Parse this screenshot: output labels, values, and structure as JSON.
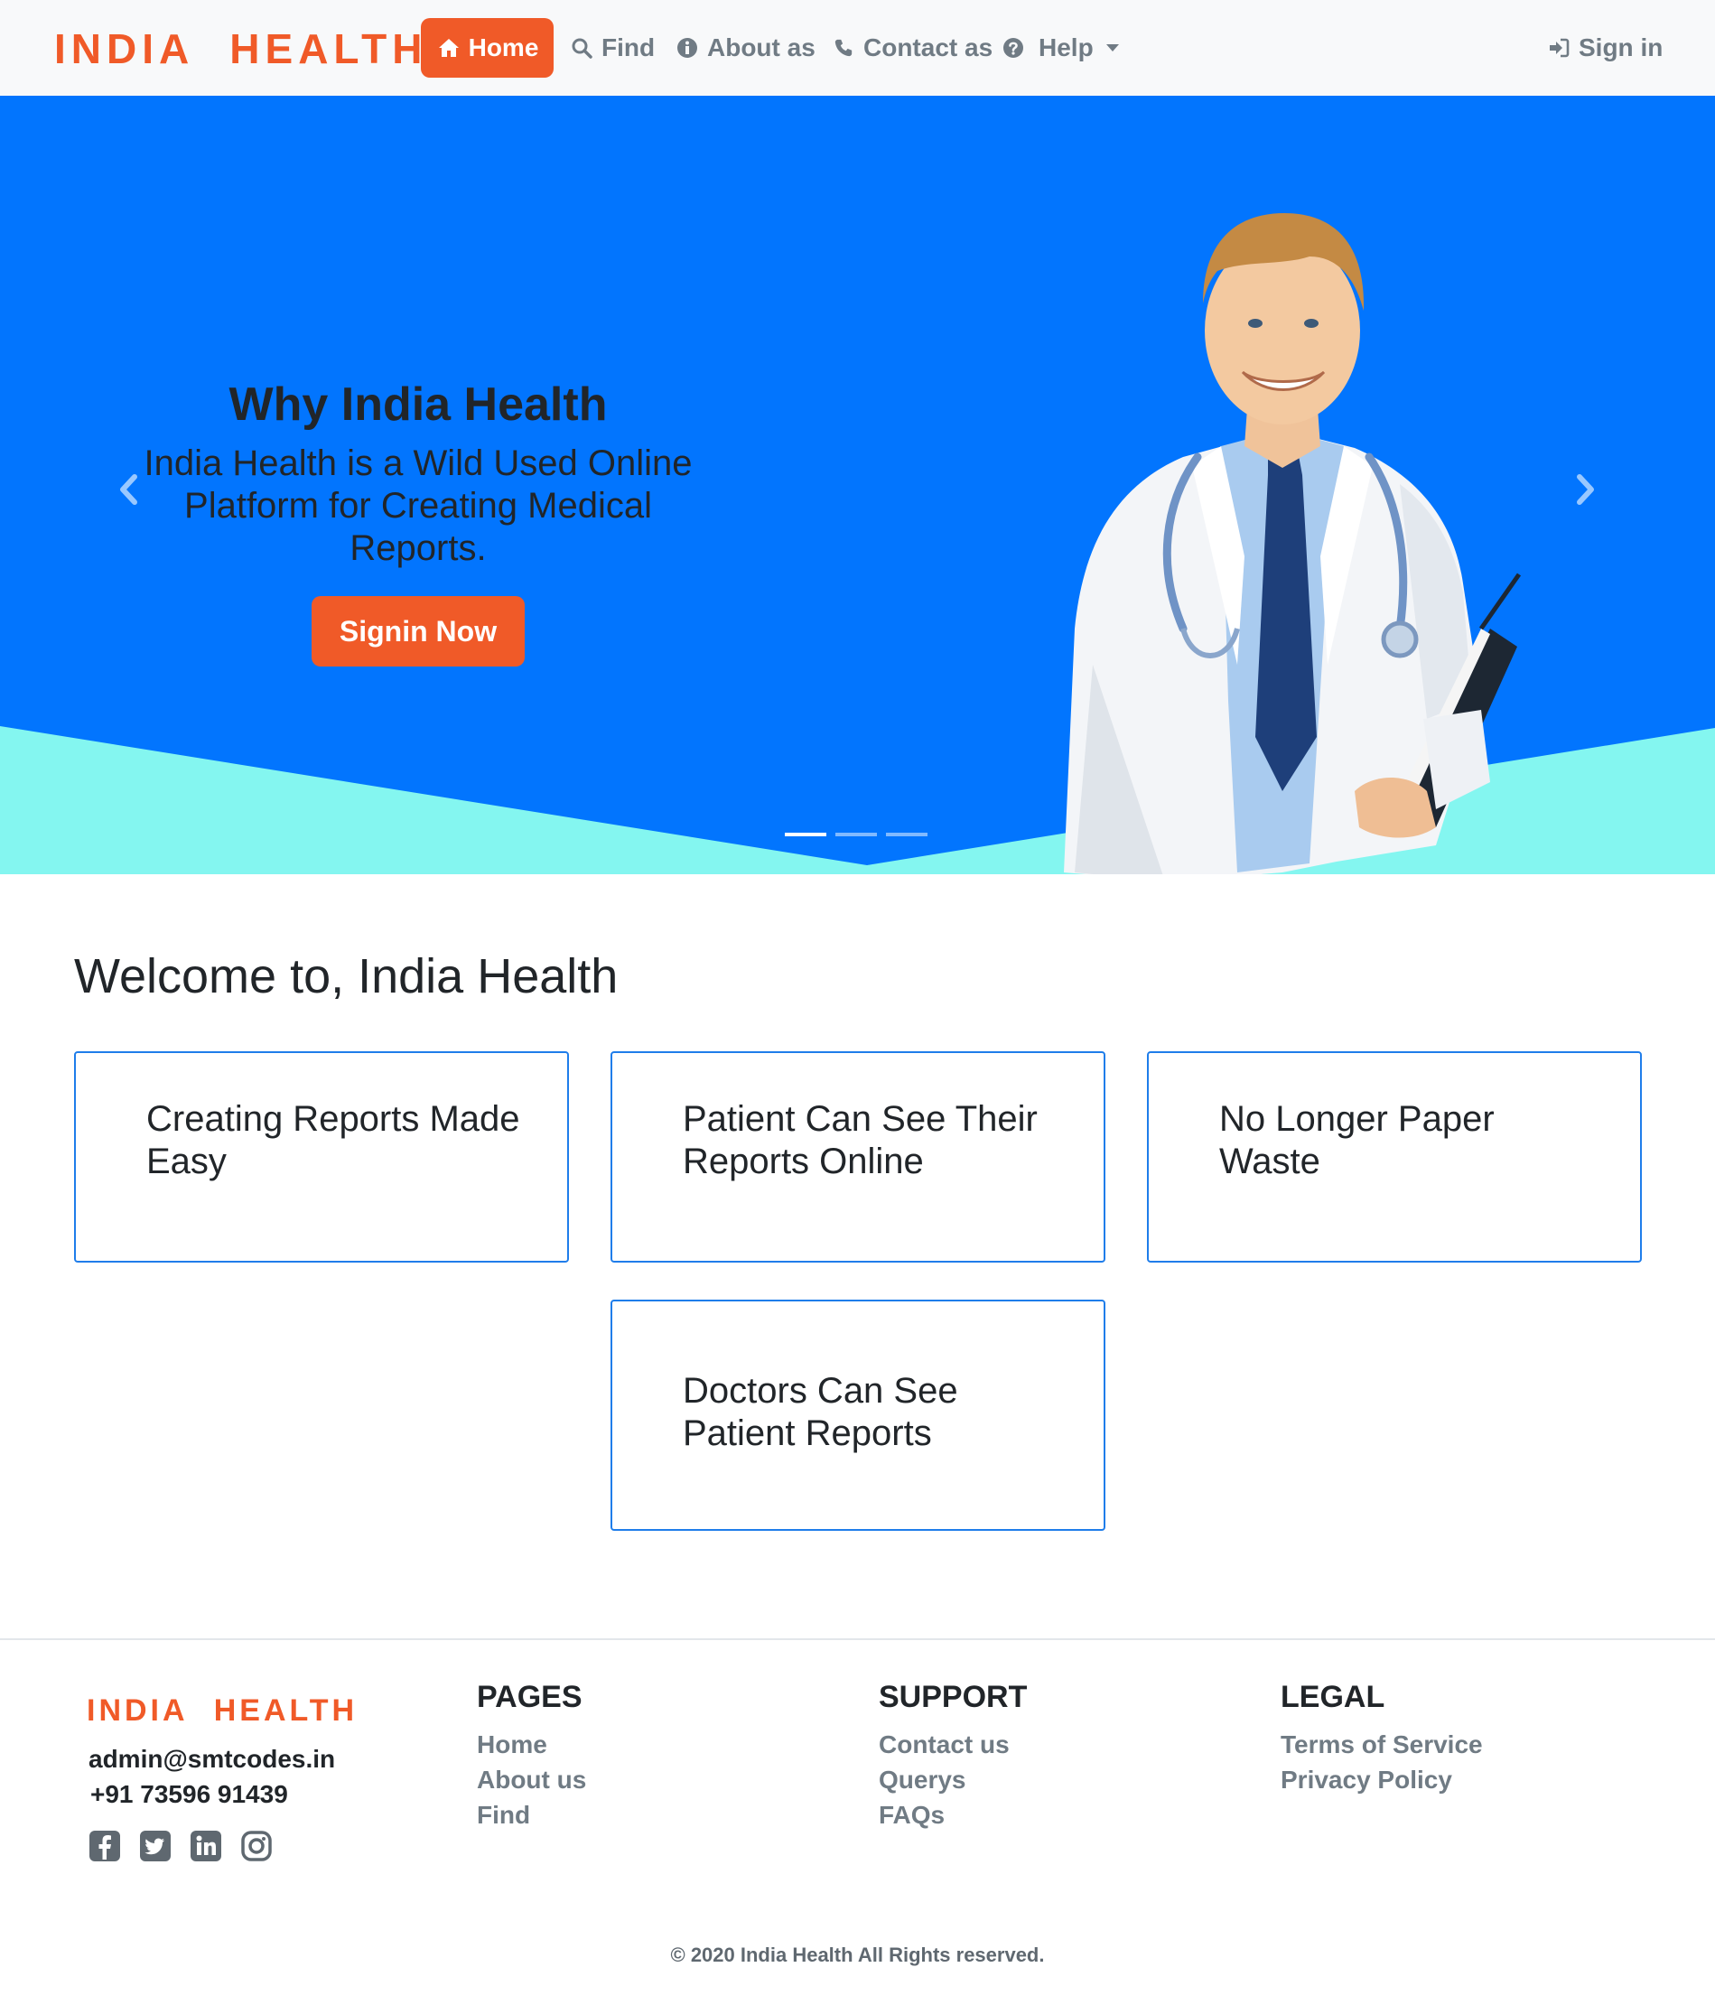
{
  "brand": {
    "name": "INDIA HEALTH",
    "color": "#f05a28"
  },
  "nav": {
    "home": "Home",
    "find": "Find",
    "about": "About as",
    "contact": "Contact as",
    "help": "Help",
    "signin": "Sign in",
    "icons": {
      "home": "home-icon",
      "find": "search-icon",
      "about": "info-circle-icon",
      "contact": "phone-icon",
      "help": "question-circle-icon",
      "signin": "sign-in-icon"
    }
  },
  "hero": {
    "title": "Why India Health",
    "subtitle": "India Health is a Wild Used Online Platform for Creating Medical Reports.",
    "button": "Signin Now",
    "slide_count": 3,
    "active_slide": 1,
    "background_color": "#0275fe",
    "wave_color": "#84f6f0"
  },
  "welcome": {
    "title": "Welcome to, India Health",
    "cards": [
      "Creating Reports Made Easy",
      "Patient Can See Their Reports Online",
      "No Longer Paper Waste",
      "Doctors Can See Patient Reports"
    ]
  },
  "footer": {
    "brand": "INDIA HEALTH",
    "email": "admin@smtcodes.in",
    "phone": "+91 73596 91439",
    "socials": [
      "facebook-icon",
      "twitter-icon",
      "linkedin-icon",
      "instagram-icon"
    ],
    "pages": {
      "title": "PAGES",
      "links": [
        "Home",
        "About us",
        "Find"
      ]
    },
    "support": {
      "title": "SUPPORT",
      "links": [
        "Contact us",
        "Querys",
        "FAQs"
      ]
    },
    "legal": {
      "title": "LEGAL",
      "links": [
        "Terms of Service",
        "Privacy Policy"
      ]
    },
    "copyright": "© 2020 India Health All Rights reserved."
  }
}
